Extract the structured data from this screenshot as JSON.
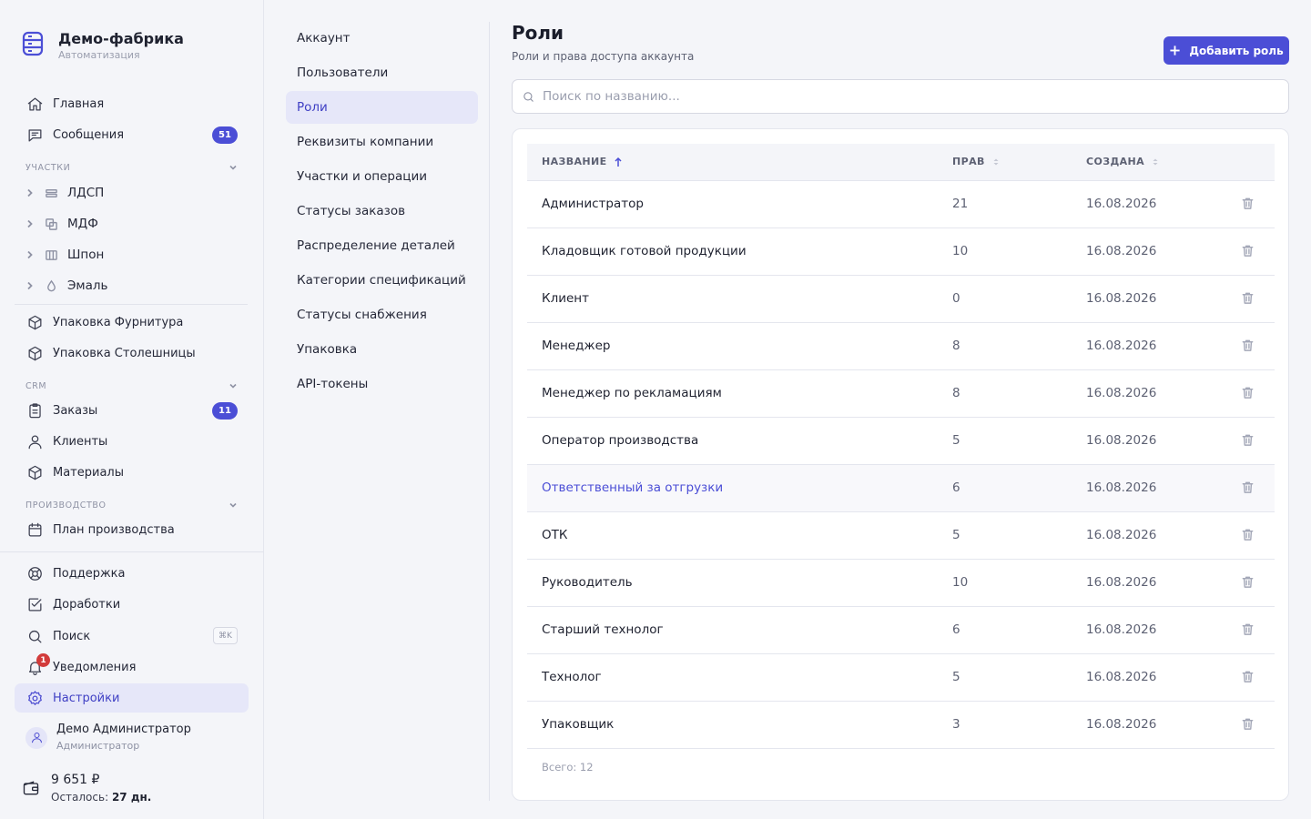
{
  "brand": {
    "title": "Демо-фабрика",
    "subtitle": "Автоматизация"
  },
  "nav": {
    "home": "Главная",
    "messages": "Сообщения",
    "messages_badge": "51",
    "section_sites": "УЧАСТКИ",
    "sites": [
      "ЛДСП",
      "МДФ",
      "Шпон",
      "Эмаль"
    ],
    "pack_fittings": "Упаковка Фурнитура",
    "pack_tops": "Упаковка Столешницы",
    "section_crm": "CRM",
    "orders": "Заказы",
    "orders_badge": "11",
    "clients": "Клиенты",
    "materials": "Материалы",
    "section_production": "ПРОИЗВОДСТВО",
    "production_plan": "План производства",
    "support": "Поддержка",
    "improvements": "Доработки",
    "search": "Поиск",
    "search_shortcut": "⌘K",
    "notifications": "Уведомления",
    "notifications_badge": "1",
    "settings": "Настройки"
  },
  "user": {
    "name": "Демо Администратор",
    "role": "Администратор"
  },
  "balance": {
    "amount": "9 651 ₽",
    "left_label": "Осталось: ",
    "left_value": "27 дн."
  },
  "settings_menu": [
    "Аккаунт",
    "Пользователи",
    "Роли",
    "Реквизиты компании",
    "Участки и операции",
    "Статусы заказов",
    "Распределение деталей",
    "Категории спецификаций",
    "Статусы снабжения",
    "Упаковка",
    "API-токены"
  ],
  "page": {
    "title": "Роли",
    "subtitle": "Роли и права доступа аккаунта",
    "add_button": "Добавить роль",
    "search_placeholder": "Поиск по названию..."
  },
  "table": {
    "columns": [
      "НАЗВАНИЕ",
      "ПРАВ",
      "СОЗДАНА"
    ],
    "rows": [
      {
        "name": "Администратор",
        "rights": "21",
        "created": "16.08.2026"
      },
      {
        "name": "Кладовщик готовой продукции",
        "rights": "10",
        "created": "16.08.2026"
      },
      {
        "name": "Клиент",
        "rights": "0",
        "created": "16.08.2026"
      },
      {
        "name": "Менеджер",
        "rights": "8",
        "created": "16.08.2026"
      },
      {
        "name": "Менеджер по рекламациям",
        "rights": "8",
        "created": "16.08.2026"
      },
      {
        "name": "Оператор производства",
        "rights": "5",
        "created": "16.08.2026"
      },
      {
        "name": "Ответственный за отгрузки",
        "rights": "6",
        "created": "16.08.2026"
      },
      {
        "name": "ОТК",
        "rights": "5",
        "created": "16.08.2026"
      },
      {
        "name": "Руководитель",
        "rights": "10",
        "created": "16.08.2026"
      },
      {
        "name": "Старший технолог",
        "rights": "6",
        "created": "16.08.2026"
      },
      {
        "name": "Технолог",
        "rights": "5",
        "created": "16.08.2026"
      },
      {
        "name": "Упаковщик",
        "rights": "3",
        "created": "16.08.2026"
      }
    ],
    "total": "Всего: 12"
  },
  "colors": {
    "accent": "#4b4ed6",
    "active_bg": "#e6e7f9",
    "badge_red": "#d23b3b"
  }
}
